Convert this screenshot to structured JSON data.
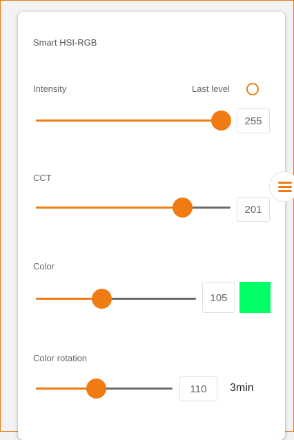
{
  "panel": {
    "title": "Smart HSI-RGB"
  },
  "intensity": {
    "label": "Intensity",
    "last_level_label": "Last level",
    "value": "255",
    "level": 1.0
  },
  "cct": {
    "label": "CCT",
    "value": "201",
    "level": 0.75
  },
  "color": {
    "label": "Color",
    "value": "105",
    "level": 0.41,
    "swatch_color": "#00ff66"
  },
  "color_rotation": {
    "label": "Color rotation",
    "value": "110",
    "duration": "3min",
    "level": 0.44
  },
  "accent_color": "#f07b13",
  "icons": {
    "menu_handle": "hamburger-icon",
    "last_level_toggle": "radio-icon"
  }
}
